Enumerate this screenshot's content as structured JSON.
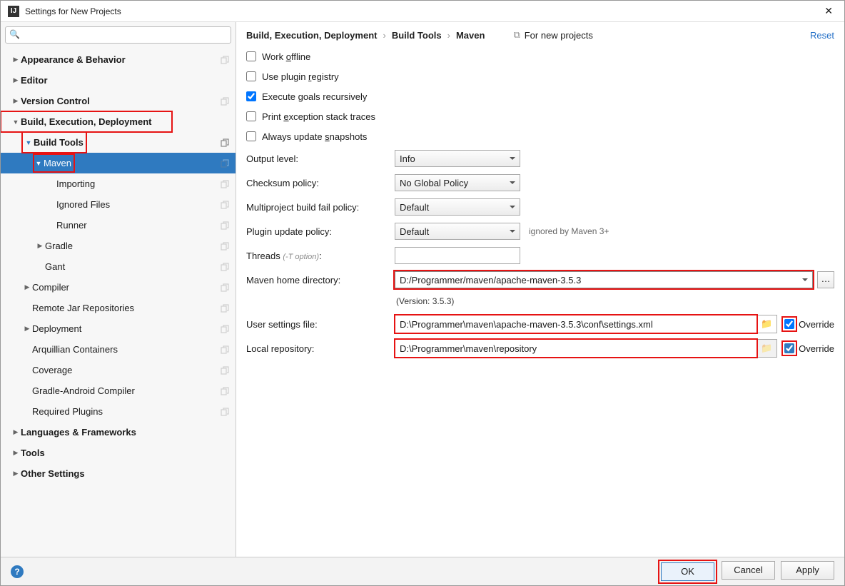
{
  "window": {
    "title": "Settings for New Projects"
  },
  "crumb": {
    "a": "Build, Execution, Deployment",
    "b": "Build Tools",
    "c": "Maven",
    "hint": "For new projects",
    "reset": "Reset"
  },
  "sidebar": {
    "search_placeholder": "",
    "items": {
      "appearance": "Appearance & Behavior",
      "editor": "Editor",
      "vcs": "Version Control",
      "bed": "Build, Execution, Deployment",
      "buildtools": "Build Tools",
      "maven": "Maven",
      "importing": "Importing",
      "ignored": "Ignored Files",
      "runner": "Runner",
      "gradle": "Gradle",
      "gant": "Gant",
      "compiler": "Compiler",
      "remotejar": "Remote Jar Repositories",
      "deployment": "Deployment",
      "arq": "Arquillian Containers",
      "coverage": "Coverage",
      "gac": "Gradle-Android Compiler",
      "reqplug": "Required Plugins",
      "langfw": "Languages & Frameworks",
      "tools": "Tools",
      "other": "Other Settings"
    }
  },
  "checks": {
    "offline": "Work offline",
    "plugin": "Use plugin registry",
    "execgoals": "Execute goals recursively",
    "printex": "Print exception stack traces",
    "always": "Always update snapshots"
  },
  "fields": {
    "output_label": "Output level:",
    "output_value": "Info",
    "checksum_label": "Checksum policy:",
    "checksum_value": "No Global Policy",
    "multi_label": "Multiproject build fail policy:",
    "multi_value": "Default",
    "plugupd_label": "Plugin update policy:",
    "plugupd_value": "Default",
    "plugupd_note": "ignored by Maven 3+",
    "threads_label": "Threads",
    "threads_hint": "(-T option)",
    "threads_value": "",
    "mavenhome_label": "Maven home directory:",
    "mavenhome_value": "D:/Programmer/maven/apache-maven-3.5.3",
    "version": "(Version: 3.5.3)",
    "usersettings_label": "User settings file:",
    "usersettings_value": "D:\\Programmer\\maven\\apache-maven-3.5.3\\conf\\settings.xml",
    "localrepo_label": "Local repository:",
    "localrepo_value": "D:\\Programmer\\maven\\repository",
    "override": "Override"
  },
  "footer": {
    "ok": "OK",
    "cancel": "Cancel",
    "apply": "Apply"
  }
}
